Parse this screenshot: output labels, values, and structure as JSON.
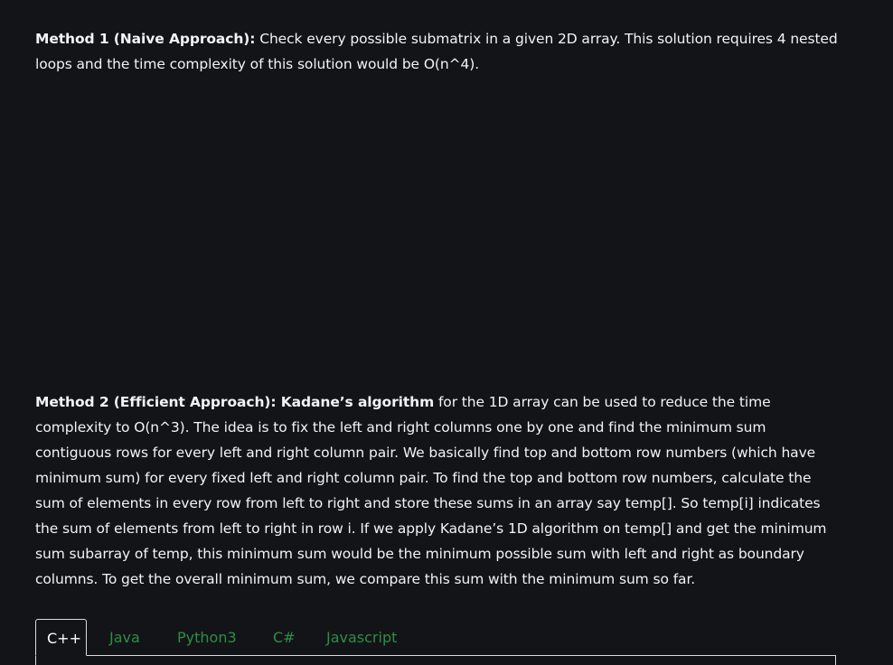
{
  "method1": {
    "label": "Method 1 (Naive Approach):",
    "text": " Check every possible submatrix in a given 2D array. This solution requires 4 nested loops and the time complexity of this solution would be O(n^4)."
  },
  "method2": {
    "label": "Method 2 (Efficient Approach): Kadane’s algorithm",
    "text": " for the 1D array can be used to reduce the time complexity to O(n^3). The idea is to fix the left and right columns one by one and find the minimum sum contiguous rows for every left and right column pair. We basically find top and bottom row numbers (which have minimum sum) for every fixed left and right column pair. To find the top and bottom row numbers, calculate the sum of elements in every row from left to right and store these sums in an array say temp[]. So temp[i] indicates the sum of elements from left to right in row i. If we apply Kadane’s 1D algorithm on temp[] and get the minimum sum subarray of temp, this minimum sum would be the minimum possible sum with left and right as boundary columns. To get the overall minimum sum, we compare this sum with the minimum sum so far."
  },
  "code_tabs": {
    "items": [
      "C++",
      "Java",
      "Python3",
      "C#",
      "Javascript"
    ],
    "active_index": 0
  },
  "colors": {
    "background": "#131417",
    "text": "#f2f3f5",
    "tab_inactive": "#2f8d46",
    "tab_border": "#dcdcdc"
  }
}
